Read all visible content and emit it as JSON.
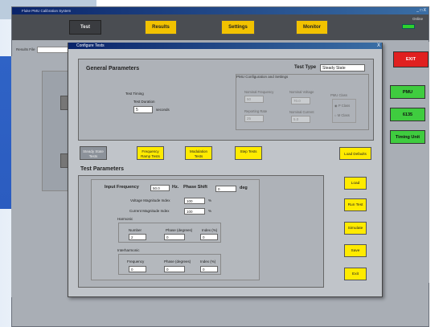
{
  "app": {
    "title": "Fluke PMU Calibration System",
    "win_controls": "_ □ X"
  },
  "tabs": [
    {
      "label": "Test",
      "active": true
    },
    {
      "label": "Results"
    },
    {
      "label": "Settings"
    },
    {
      "label": "Monitor"
    }
  ],
  "status": {
    "online_label": "Online",
    "online_color": "#2cd32c"
  },
  "results_file_label": "Results File",
  "side_buttons": {
    "exit": "EXIT",
    "pmu": "PMU",
    "n135": "6135",
    "timing": "Timing Unit"
  },
  "dialog": {
    "title": "Configure Tests",
    "close": "X",
    "general": {
      "title": "General Parameters",
      "test_type_label": "Test Type",
      "test_type_value": "Steady State",
      "test_timing": "Test Timing",
      "test_duration": "Test Duration",
      "duration_value": "5",
      "duration_unit": "seconds",
      "pmu_cfg_title": "PMU Configuration and Settings",
      "nominal_freq_label": "Nominal Frequency",
      "nominal_freq_value": "50",
      "reporting_rate_label": "Reporting Rate",
      "reporting_rate_value": "25",
      "nominal_voltage_label": "Nominal Voltage",
      "nominal_voltage_value": "70.0",
      "nominal_current_label": "Nominal Current",
      "nominal_current_value": "5.0",
      "pmu_class_label": "PMU Class",
      "class_p": "P Class",
      "class_m": "M Class"
    },
    "test_tabs": [
      "Steady State Tests",
      "Frequency Ramp Tests",
      "Modulation Tests",
      "Step Tests"
    ],
    "load_defaults": "Load Defaults",
    "test_params": {
      "title": "Test Parameters",
      "input_freq_label": "Input Frequency",
      "input_freq_value": "50.0",
      "hz": "Hz.",
      "phase_shift_label": "Phase Shift",
      "phase_shift_value": "0",
      "deg": "deg",
      "voltage_mag_label": "Voltage Magnitude Index",
      "voltage_mag_value": "100",
      "current_mag_label": "Current Magnitude Index",
      "current_mag_value": "100",
      "pct": "%",
      "harmonic_title": "Harmonic",
      "harm_cols": [
        "Number",
        "Phase (degrees)",
        "Index (%)"
      ],
      "harm_vals": [
        "2",
        "0",
        "0"
      ],
      "inter_title": "Interharmonic",
      "inter_cols": [
        "Frequency",
        "Phase (degrees)",
        "Index (%)"
      ],
      "inter_vals": [
        "0",
        "0",
        "0"
      ]
    },
    "right_buttons": [
      "Load",
      "Run Test",
      "Simulate",
      "Save",
      "Exit"
    ]
  }
}
